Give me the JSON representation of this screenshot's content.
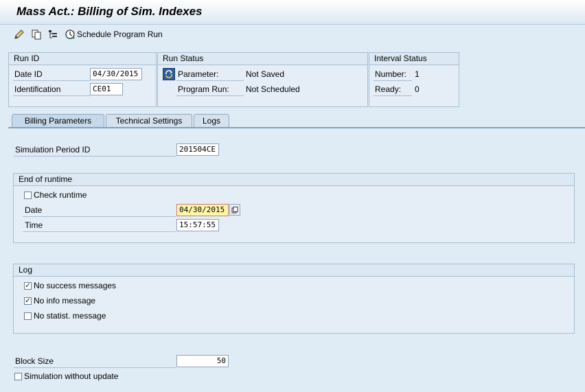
{
  "header": {
    "title": "Mass Act.: Billing of Sim. Indexes"
  },
  "toolbar": {
    "schedule_label": "Schedule Program Run"
  },
  "run_id": {
    "heading": "Run ID",
    "date_label": "Date ID",
    "date_value": "04/30/2015",
    "ident_label": "Identification",
    "ident_value": "CE01"
  },
  "run_status": {
    "heading": "Run Status",
    "param_label": "Parameter:",
    "param_value": "Not Saved",
    "prog_label": "Program Run:",
    "prog_value": "Not Scheduled"
  },
  "interval_status": {
    "heading": "Interval Status",
    "number_label": "Number:",
    "number_value": "1",
    "ready_label": "Ready:",
    "ready_value": "0"
  },
  "tabs": [
    {
      "label": "Billing Parameters"
    },
    {
      "label": "Technical Settings"
    },
    {
      "label": "Logs"
    }
  ],
  "billing": {
    "sim_period_label": "Simulation Period ID",
    "sim_period_value": "201504CE",
    "end_runtime": {
      "heading": "End of runtime",
      "check_label": "Check runtime",
      "check_checked": false,
      "date_label": "Date",
      "date_value": "04/30/2015",
      "time_label": "Time",
      "time_value": "15:57:55"
    },
    "log": {
      "heading": "Log",
      "items": [
        {
          "label": "No success messages",
          "checked": true
        },
        {
          "label": "No info message",
          "checked": true
        },
        {
          "label": "No statist. message",
          "checked": false
        }
      ]
    },
    "block_size_label": "Block Size",
    "block_size_value": "50",
    "sim_no_update_label": "Simulation without update",
    "sim_no_update_checked": false
  },
  "colors": {
    "background": "#dfebf5",
    "required_field": "#fff8a8",
    "tab_border": "#7fa3c4"
  }
}
